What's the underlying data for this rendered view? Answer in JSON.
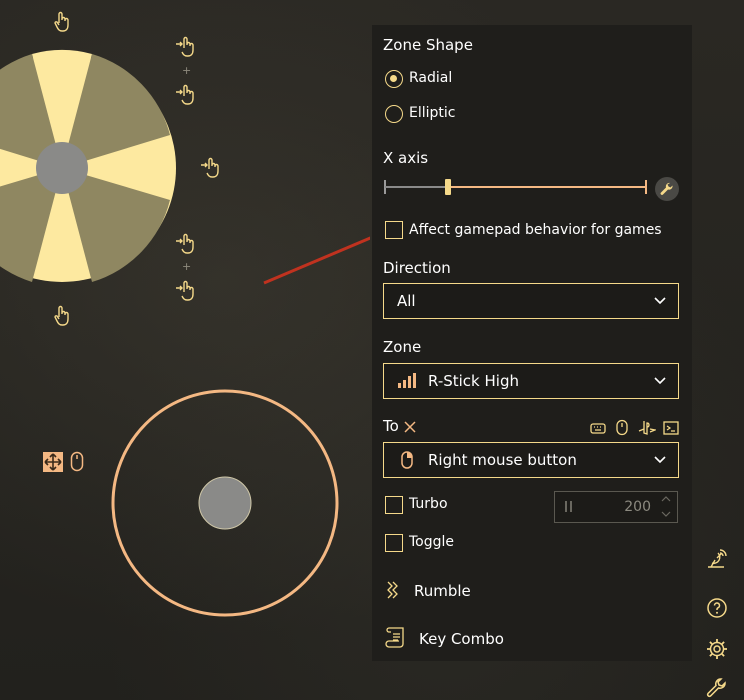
{
  "zone_shape": {
    "title": "Zone Shape",
    "options": [
      {
        "label": "Radial",
        "selected": true
      },
      {
        "label": "Elliptic",
        "selected": false
      }
    ]
  },
  "x_axis": {
    "title": "X axis",
    "range_low_fraction": 0.24,
    "range_high_fraction": 1.0
  },
  "affect_gamepad": {
    "label": "Affect gamepad behavior for games",
    "checked": false
  },
  "direction": {
    "title": "Direction",
    "value": "All"
  },
  "zone": {
    "title": "Zone",
    "value": "R-Stick High",
    "icon": "signal-bars-icon"
  },
  "to": {
    "title": "To",
    "value": "Right mouse button",
    "icon": "mouse-icon",
    "target_icons": [
      "keyboard-icon",
      "mouse-icon",
      "playstation-icon",
      "console-icon"
    ]
  },
  "turbo": {
    "label": "Turbo",
    "checked": false,
    "value": "200"
  },
  "toggle": {
    "label": "Toggle",
    "checked": false
  },
  "rumble": {
    "label": "Rumble"
  },
  "key_combo": {
    "label": "Key Combo"
  },
  "sidebar_icons": [
    "satellite-icon",
    "help-icon",
    "gear-icon",
    "wrench-icon"
  ],
  "colors": {
    "accent": "#f5d98a",
    "slider": "#f4b883",
    "panel": "#1f1e1b",
    "wheel_light": "#fde9a0",
    "wheel_dark": "#8f8761",
    "stick_ring": "#f4b883",
    "annotation_arrow": "#c0321f"
  }
}
